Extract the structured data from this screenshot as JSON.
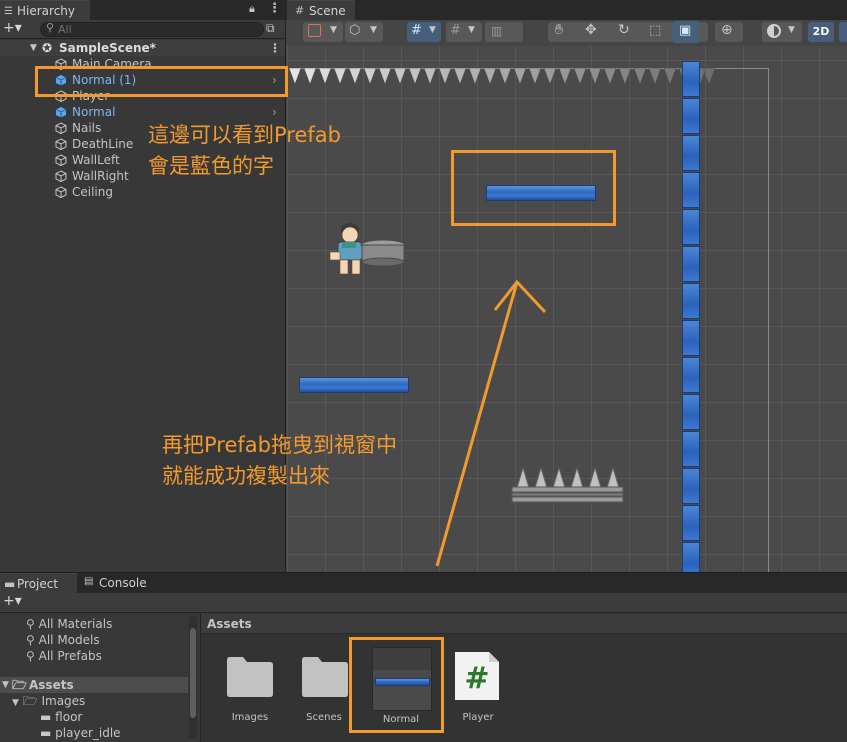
{
  "hierarchy": {
    "tab_label": "Hierarchy",
    "add_label": "+▾",
    "search_placeholder": "All",
    "scene_name": "SampleScene*",
    "items": [
      {
        "label": "Main Camera",
        "prefab": false
      },
      {
        "label": "Normal (1)",
        "prefab": true
      },
      {
        "label": "Player",
        "prefab": false
      },
      {
        "label": "Normal",
        "prefab": true
      },
      {
        "label": "Nails",
        "prefab": false
      },
      {
        "label": "DeathLine",
        "prefab": false
      },
      {
        "label": "WallLeft",
        "prefab": false
      },
      {
        "label": "WallRight",
        "prefab": false
      },
      {
        "label": "Ceiling",
        "prefab": false
      }
    ]
  },
  "scene": {
    "tab_label": "Scene",
    "mode_2d": "2D"
  },
  "annotations": {
    "note1_line1": "這邊可以看到Prefab",
    "note1_line2": "會是藍色的字",
    "note2_line1": "再把Prefab拖曳到視窗中",
    "note2_line2": "就能成功複製出來"
  },
  "project": {
    "tab_project": "Project",
    "tab_console": "Console",
    "favorites": [
      "All Materials",
      "All Models",
      "All Prefabs"
    ],
    "assets_root": "Assets",
    "tree": [
      "Images",
      "floor",
      "player_idle"
    ],
    "breadcrumb": "Assets",
    "assets": [
      {
        "label": "Images",
        "type": "folder"
      },
      {
        "label": "Scenes",
        "type": "folder"
      },
      {
        "label": "Normal",
        "type": "prefab"
      },
      {
        "label": "Player",
        "type": "script"
      }
    ]
  },
  "colors": {
    "accent_annotation": "#f29a2e",
    "prefab_text": "#7eb5f5",
    "panel_bg": "#383838"
  }
}
